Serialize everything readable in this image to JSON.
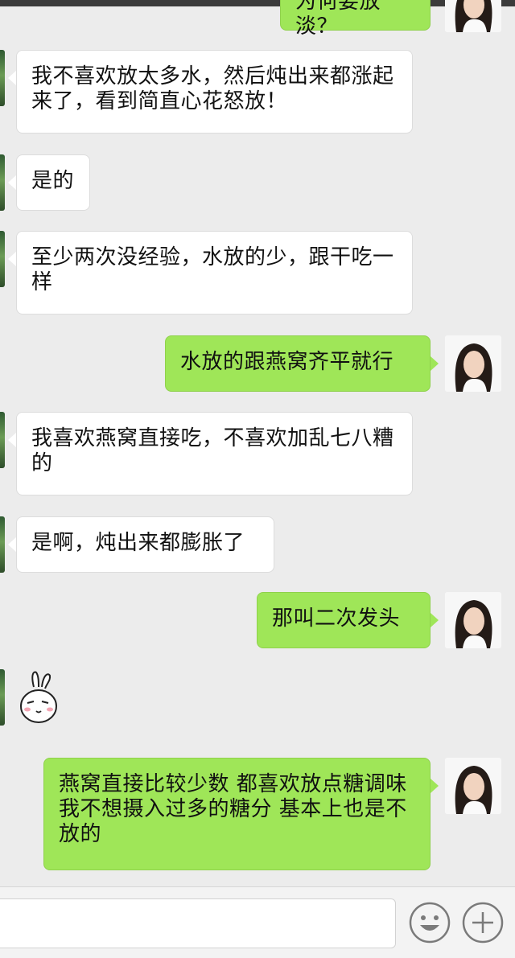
{
  "messages": [
    {
      "side": "out",
      "text": "为何要放淡？"
    },
    {
      "side": "in",
      "text": "我不喜欢放太多水，然后炖出来都涨起来了，看到简直心花怒放！"
    },
    {
      "side": "in",
      "text": "是的"
    },
    {
      "side": "in",
      "text": "至少两次没经验，水放的少，跟干吃一样"
    },
    {
      "side": "out",
      "text": "水放的跟燕窝齐平就行"
    },
    {
      "side": "in",
      "text": "我喜欢燕窝直接吃，不喜欢加乱七八糟的"
    },
    {
      "side": "in",
      "text": "是啊，炖出来都膨胀了"
    },
    {
      "side": "out",
      "text": "那叫二次发头"
    },
    {
      "side": "in",
      "type": "sticker",
      "text": ""
    },
    {
      "side": "out",
      "text": "燕窝直接比较少数 都喜欢放点糖调味 我不想摄入过多的糖分 基本上也是不放的"
    }
  ],
  "icons": {
    "emoji": "smiley-face-icon",
    "more": "plus-circle-icon",
    "sticker": "bunny-sticker-icon"
  },
  "colors": {
    "outgoing_bubble": "#9fe658",
    "incoming_bubble": "#ffffff",
    "background": "#ececec"
  }
}
